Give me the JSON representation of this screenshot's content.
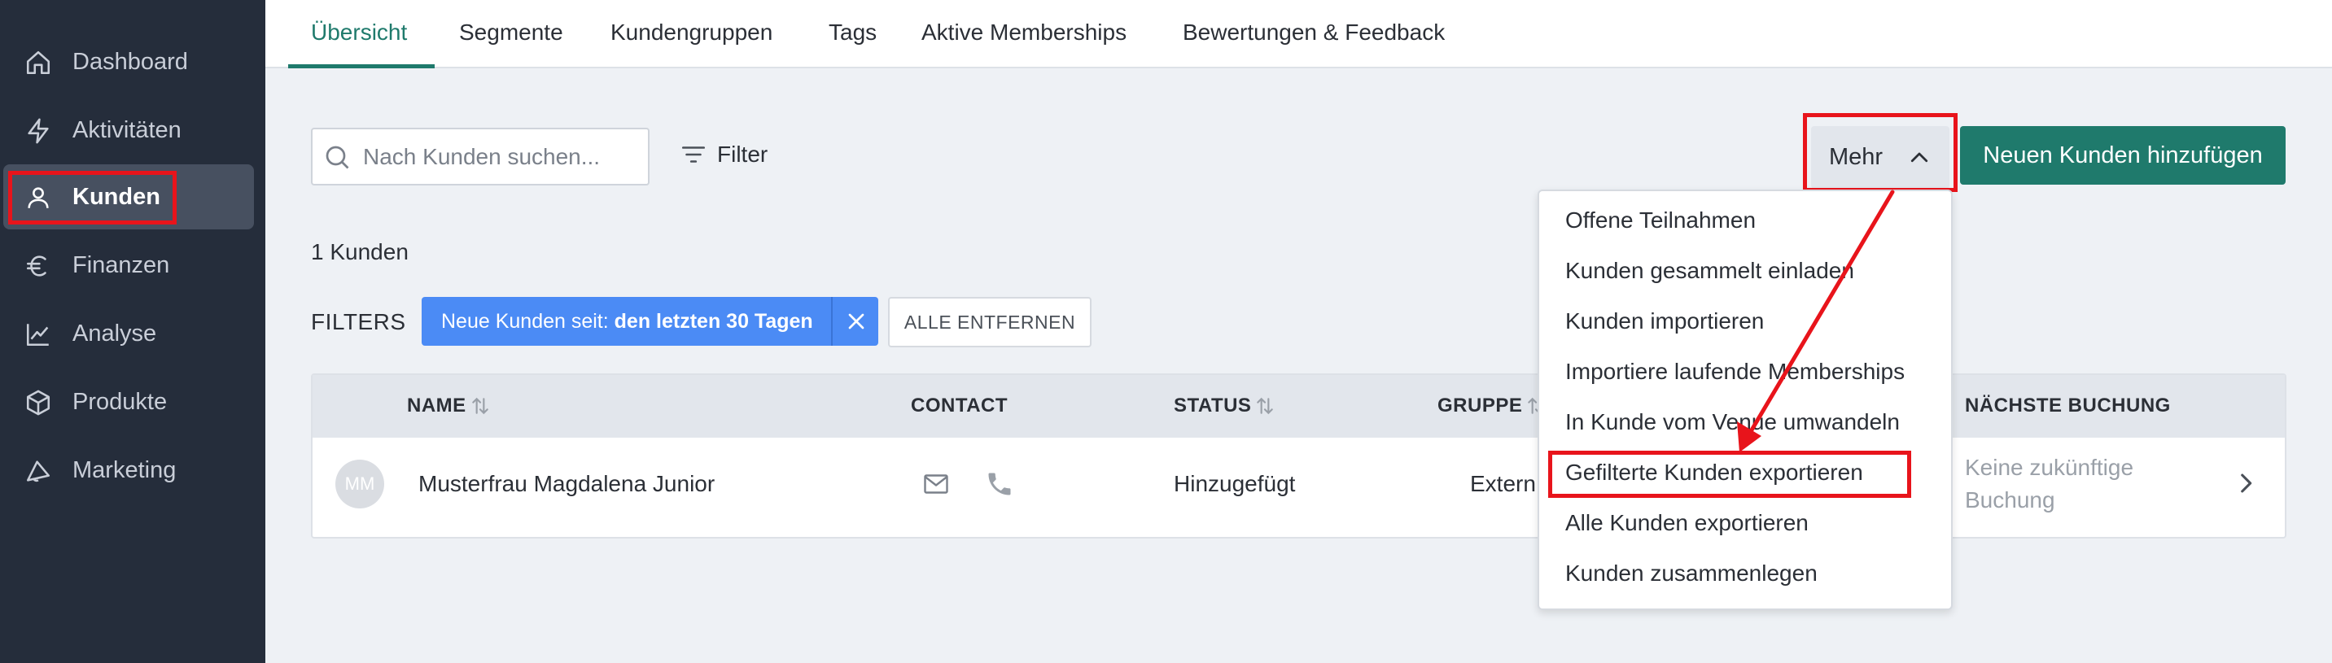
{
  "sidebar": {
    "items": [
      {
        "label": "Dashboard",
        "icon": "home-icon"
      },
      {
        "label": "Aktivitäten",
        "icon": "bolt-icon"
      },
      {
        "label": "Kunden",
        "icon": "user-icon",
        "active": true
      },
      {
        "label": "Finanzen",
        "icon": "euro-icon"
      },
      {
        "label": "Analyse",
        "icon": "chart-line-icon"
      },
      {
        "label": "Produkte",
        "icon": "box-icon"
      },
      {
        "label": "Marketing",
        "icon": "megaphone-icon"
      }
    ]
  },
  "tabs": [
    {
      "label": "Übersicht",
      "active": true
    },
    {
      "label": "Segmente"
    },
    {
      "label": "Kundengruppen"
    },
    {
      "label": "Tags"
    },
    {
      "label": "Aktive Memberships"
    },
    {
      "label": "Bewertungen & Feedback"
    }
  ],
  "toolbar": {
    "search_placeholder": "Nach Kunden suchen...",
    "filter_label": "Filter",
    "more_label": "Mehr",
    "add_label": "Neuen Kunden hinzufügen"
  },
  "customer_count": "1 Kunden",
  "filters": {
    "label": "FILTERS",
    "chip_prefix": "Neue Kunden seit:",
    "chip_value": "den letzten 30 Tagen",
    "remove_all_label": "ALLE ENTFERNEN"
  },
  "table": {
    "columns": [
      "NAME",
      "CONTACT",
      "STATUS",
      "GRUPPE",
      "NÄCHSTE BUCHUNG"
    ],
    "rows": [
      {
        "initials": "MM",
        "name": "Musterfrau Magdalena Junior",
        "status": "Hinzugefügt",
        "group": "Extern",
        "next_booking_line1": "Keine zukünftige",
        "next_booking_line2": "Buchung"
      }
    ]
  },
  "more_menu": {
    "items": [
      "Offene Teilnahmen",
      "Kunden gesammelt einladen",
      "Kunden importieren",
      "Importiere laufende Memberships",
      "In Kunde vom Venue umwandeln",
      "Gefilterte Kunden exportieren",
      "Alle Kunden exportieren",
      "Kunden zusammenlegen"
    ]
  },
  "colors": {
    "sidebar_bg": "#252d3b",
    "accent": "#1f7a6c",
    "chip_blue": "#4b8bf5",
    "annotation_red": "#e8141b"
  }
}
